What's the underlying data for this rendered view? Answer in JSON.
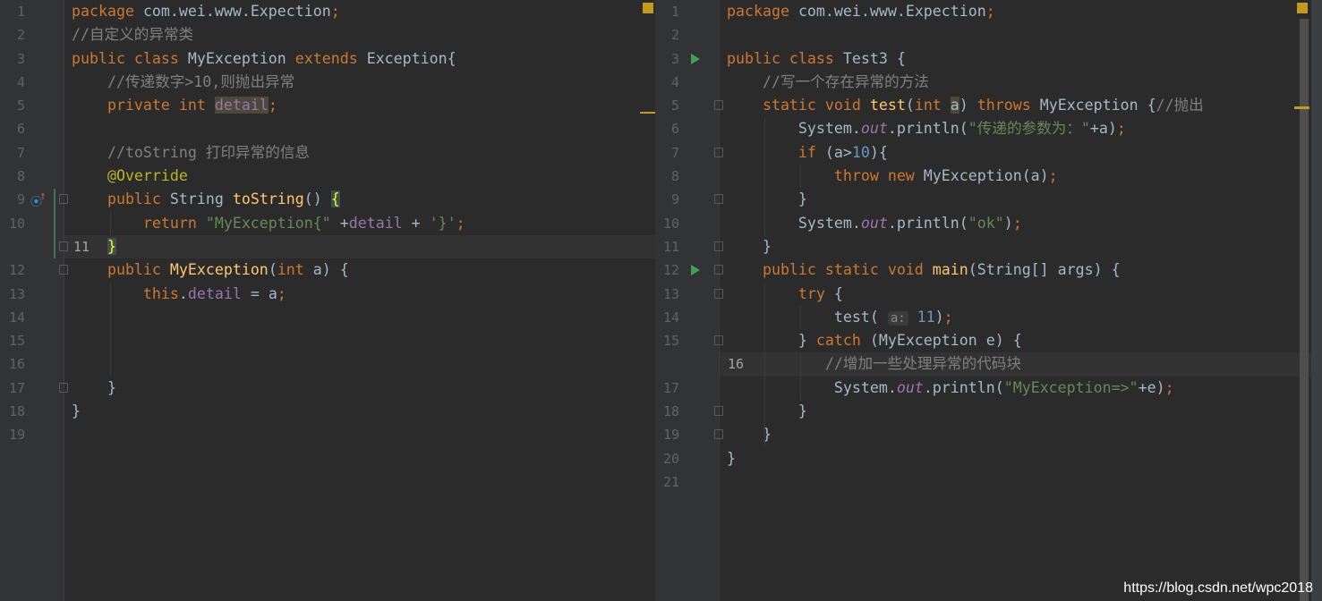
{
  "left_editor": {
    "current_line": 11,
    "lines": [
      [
        [
          "kw",
          "package "
        ],
        [
          "pl",
          "com.wei.www.Expection"
        ],
        [
          "kw",
          ";"
        ]
      ],
      [
        [
          "cm",
          "//自定义的异常类"
        ]
      ],
      [
        [
          "kw",
          "public class "
        ],
        [
          "pl",
          "MyException "
        ],
        [
          "kw",
          "extends "
        ],
        [
          "pl",
          "Exception{"
        ]
      ],
      [
        [
          "cm",
          "    //传递数字>10,则抛出异常"
        ]
      ],
      [
        [
          "kw",
          "    private int "
        ],
        [
          "hlv",
          "detail"
        ],
        [
          "kw",
          ";"
        ]
      ],
      [],
      [
        [
          "cm",
          "    //toString 打印异常的信息"
        ]
      ],
      [
        [
          "ann",
          "    @Override"
        ]
      ],
      [
        [
          "kw",
          "    public "
        ],
        [
          "pl",
          "String "
        ],
        [
          "fn",
          "toString"
        ],
        [
          "pl",
          "() "
        ],
        [
          "brc",
          "{"
        ]
      ],
      [
        [
          "kw",
          "        return "
        ],
        [
          "str",
          "\"MyException{\" "
        ],
        [
          "pl",
          "+"
        ],
        [
          "fld",
          "detail"
        ],
        [
          "pl",
          " + "
        ],
        [
          "str",
          "'}'"
        ],
        [
          "kw",
          ";"
        ]
      ],
      [
        [
          "pl",
          "    "
        ],
        [
          "brc",
          "}"
        ]
      ],
      [
        [
          "kw",
          "    public "
        ],
        [
          "fn",
          "MyException"
        ],
        [
          "pl",
          "("
        ],
        [
          "kw",
          "int "
        ],
        [
          "pl",
          "a) {"
        ]
      ],
      [
        [
          "kw",
          "        this"
        ],
        [
          "pl",
          "."
        ],
        [
          "fld",
          "detail"
        ],
        [
          "pl",
          " = a"
        ],
        [
          "kw",
          ";"
        ]
      ],
      [],
      [],
      [],
      [
        [
          "pl",
          "    }"
        ]
      ],
      [
        [
          "pl",
          "}"
        ]
      ],
      []
    ]
  },
  "right_editor": {
    "current_line": 16,
    "lines": [
      [
        [
          "kw",
          "package "
        ],
        [
          "pl",
          "com.wei.www.Expection"
        ],
        [
          "kw",
          ";"
        ]
      ],
      [],
      [
        [
          "kw",
          "public class "
        ],
        [
          "pl",
          "Test3 {"
        ]
      ],
      [
        [
          "cm",
          "    //写一个存在异常的方法"
        ]
      ],
      [
        [
          "kw",
          "    static void "
        ],
        [
          "fn",
          "test"
        ],
        [
          "pl",
          "("
        ],
        [
          "kw",
          "int "
        ],
        [
          "hla",
          "a"
        ],
        [
          "pl",
          ") "
        ],
        [
          "kw",
          "throws "
        ],
        [
          "pl",
          "MyException {"
        ],
        [
          "cm",
          "//抛出"
        ]
      ],
      [
        [
          "pl",
          "        System."
        ],
        [
          "it",
          "out"
        ],
        [
          "pl",
          ".println("
        ],
        [
          "str",
          "\"传递的参数为：\""
        ],
        [
          "pl",
          "+a)"
        ],
        [
          "kw",
          ";"
        ]
      ],
      [
        [
          "kw",
          "        if "
        ],
        [
          "pl",
          "(a>"
        ],
        [
          "nm",
          "10"
        ],
        [
          "pl",
          "){"
        ]
      ],
      [
        [
          "kw",
          "            throw new "
        ],
        [
          "pl",
          "MyException(a)"
        ],
        [
          "kw",
          ";"
        ]
      ],
      [
        [
          "pl",
          "        }"
        ]
      ],
      [
        [
          "pl",
          "        System."
        ],
        [
          "it",
          "out"
        ],
        [
          "pl",
          ".println("
        ],
        [
          "str",
          "\"ok\""
        ],
        [
          "pl",
          ")"
        ],
        [
          "kw",
          ";"
        ]
      ],
      [
        [
          "pl",
          "    }"
        ]
      ],
      [
        [
          "kw",
          "    public static void "
        ],
        [
          "fn",
          "main"
        ],
        [
          "pl",
          "(String[] args) {"
        ]
      ],
      [
        [
          "kw",
          "        try "
        ],
        [
          "pl",
          "{"
        ]
      ],
      [
        [
          "pl",
          "            test( "
        ],
        [
          "hint",
          "a:"
        ],
        [
          "nm",
          " 11"
        ],
        [
          "pl",
          ")"
        ],
        [
          "kw",
          ";"
        ]
      ],
      [
        [
          "pl",
          "        } "
        ],
        [
          "kw",
          "catch "
        ],
        [
          "pl",
          "(MyException e) {"
        ]
      ],
      [
        [
          "cm",
          "           //增加一些处理异常的代码块"
        ]
      ],
      [
        [
          "pl",
          "            System."
        ],
        [
          "it",
          "out"
        ],
        [
          "pl",
          ".println("
        ],
        [
          "str",
          "\"MyException=>\""
        ],
        [
          "pl",
          "+e)"
        ],
        [
          "kw",
          ";"
        ]
      ],
      [
        [
          "pl",
          "        }"
        ]
      ],
      [
        [
          "pl",
          "    }"
        ]
      ],
      [
        [
          "pl",
          "}"
        ]
      ],
      []
    ]
  },
  "watermark": "https://blog.csdn.net/wpc2018"
}
